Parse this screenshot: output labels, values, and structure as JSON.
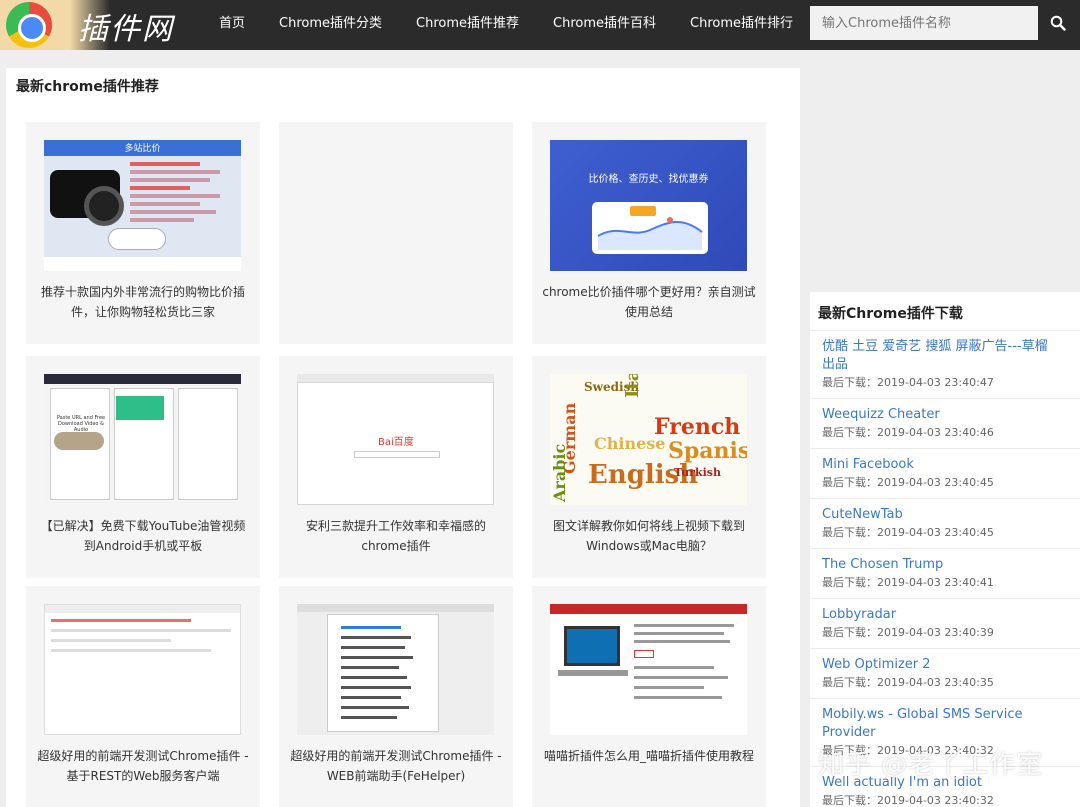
{
  "site": {
    "logo_text": "插件网"
  },
  "nav": {
    "items": [
      {
        "label": "首页"
      },
      {
        "label": "Chrome插件分类"
      },
      {
        "label": "Chrome插件推荐"
      },
      {
        "label": "Chrome插件百科"
      },
      {
        "label": "Chrome插件排行"
      }
    ]
  },
  "search": {
    "placeholder": "输入Chrome插件名称"
  },
  "main": {
    "title": "最新chrome插件推荐",
    "cards": [
      {
        "title": "推荐十款国内外非常流行的购物比价插件，让你购物轻松货比三家",
        "thumb_text": "多站比价"
      },
      {
        "title": ""
      },
      {
        "title": "chrome比价插件哪个更好用？亲自测试使用总结",
        "thumb_text": "比价格、查历史、找优惠券"
      },
      {
        "title": "【已解决】免费下载YouTube油管视频到Android手机或平板",
        "thumb_text": "Paste URL and Free Download Video & Audio"
      },
      {
        "title": "安利三款提升工作效率和幸福感的chrome插件",
        "thumb_text": "Bai百度"
      },
      {
        "title": "图文详解教你如何将线上视频下载到Windows或Mac电脑？",
        "thumb_words": [
          "Swedish",
          "Italian",
          "German",
          "Chinese",
          "French",
          "Spanish",
          "Arabic",
          "English",
          "Turkish"
        ]
      },
      {
        "title": "超级好用的前端开发测试Chrome插件 - 基于REST的Web服务客户端"
      },
      {
        "title": "超级好用的前端开发测试Chrome插件 - WEB前端助手(FeHelper)"
      },
      {
        "title": "喵喵折插件怎么用_喵喵折插件使用教程"
      }
    ]
  },
  "sidebar": {
    "title": "最新Chrome插件下载",
    "items": [
      {
        "name": "优酷 土豆 爱奇艺 搜狐 屏蔽广告---草榴出品",
        "time": "最后下载：2019-04-03 23:40:47"
      },
      {
        "name": "Weequizz Cheater",
        "time": "最后下载：2019-04-03 23:40:46"
      },
      {
        "name": "Mini Facebook",
        "time": "最后下载：2019-04-03 23:40:45"
      },
      {
        "name": "CuteNewTab",
        "time": "最后下载：2019-04-03 23:40:45"
      },
      {
        "name": "The Chosen Trump",
        "time": "最后下载：2019-04-03 23:40:41"
      },
      {
        "name": "Lobbyradar",
        "time": "最后下载：2019-04-03 23:40:39"
      },
      {
        "name": "Web Optimizer 2",
        "time": "最后下载：2019-04-03 23:40:35"
      },
      {
        "name": "Mobily.ws - Global SMS Service Provider",
        "time": "最后下载：2019-04-03 23:40:32"
      },
      {
        "name": "Well actually I'm an idiot",
        "time": "最后下载：2019-04-03 23:40:32"
      }
    ]
  },
  "watermark": "知乎 @老丫工作室"
}
